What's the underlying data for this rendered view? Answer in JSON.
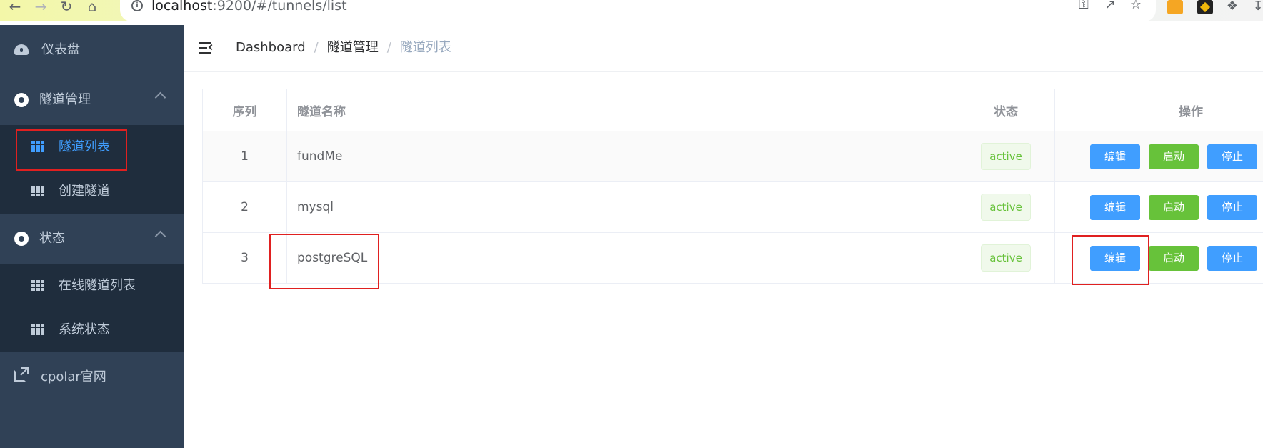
{
  "browser": {
    "url_host": "localhost",
    "url_rest": ":9200/#/tunnels/list",
    "back_icon": "arrow-left-icon",
    "forward_icon": "arrow-right-icon",
    "reload_icon": "reload-icon",
    "home_icon": "home-icon"
  },
  "sidebar": {
    "dashboard": "仪表盘",
    "tunnel_mgmt": "隧道管理",
    "tunnel_list": "隧道列表",
    "create_tunnel": "创建隧道",
    "status": "状态",
    "online_tunnels": "在线隧道列表",
    "system_status": "系统状态",
    "website": "cpolar官网"
  },
  "breadcrumb": {
    "items": [
      "Dashboard",
      "隧道管理",
      "隧道列表"
    ],
    "separator": "/"
  },
  "table": {
    "headers": [
      "序列",
      "隧道名称",
      "状态",
      "操作"
    ],
    "rows": [
      {
        "index": "1",
        "name": "fundMe",
        "status": "active"
      },
      {
        "index": "2",
        "name": "mysql",
        "status": "active"
      },
      {
        "index": "3",
        "name": "postgreSQL",
        "status": "active"
      }
    ],
    "actions": {
      "edit": "编辑",
      "start": "启动",
      "stop": "停止"
    }
  },
  "colors": {
    "sidebar_bg": "#304156",
    "submenu_bg": "#1f2d3d",
    "primary": "#409eff",
    "success": "#67c23a",
    "highlight": "#e02020"
  }
}
